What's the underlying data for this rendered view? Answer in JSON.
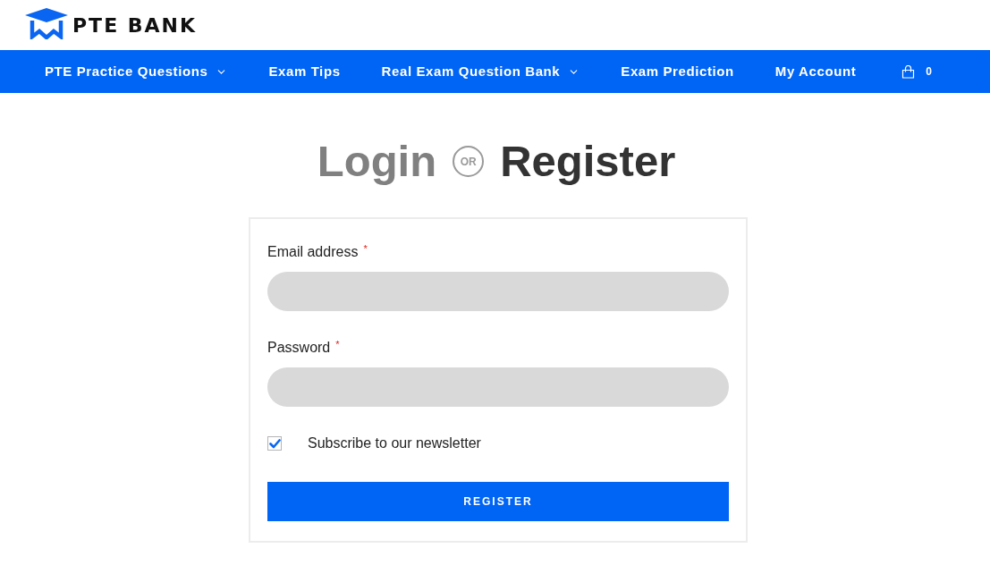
{
  "header": {
    "logo_text": "PTE BANK"
  },
  "nav": {
    "items": [
      {
        "label": "PTE Practice Questions",
        "has_dropdown": true
      },
      {
        "label": "Exam Tips",
        "has_dropdown": false
      },
      {
        "label": "Real Exam Question Bank",
        "has_dropdown": true
      },
      {
        "label": "Exam Prediction",
        "has_dropdown": false
      },
      {
        "label": "My Account",
        "has_dropdown": false
      }
    ],
    "cart": {
      "count": "0"
    }
  },
  "heading": {
    "tabs": [
      {
        "label": "Login",
        "selected": false
      },
      {
        "label": "Register",
        "selected": true
      }
    ],
    "separator": "OR"
  },
  "form": {
    "fields": [
      {
        "label": "Email address",
        "required_mark": "*"
      },
      {
        "label": "Password",
        "required_mark": "*"
      }
    ],
    "newsletter": {
      "label": "Subscribe to our newsletter",
      "checked": true
    },
    "submit": {
      "label": "REGISTER"
    }
  }
}
